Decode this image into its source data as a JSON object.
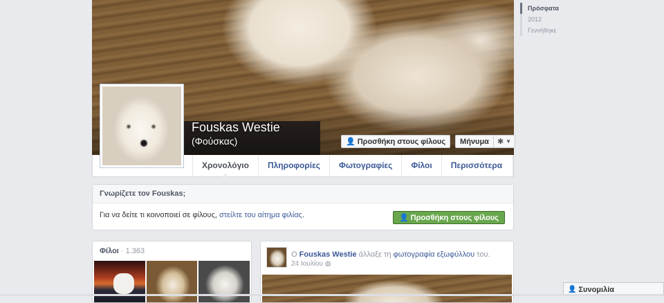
{
  "profile": {
    "name": "Fouskas Westie",
    "alternate_name": "(Φούσκας)"
  },
  "actions": {
    "add_friend": "Προσθήκη στους φίλους",
    "message": "Μήνυμα"
  },
  "tabs": [
    {
      "label": "Χρονολόγιο"
    },
    {
      "label": "Πληροφορίες"
    },
    {
      "label": "Φωτογραφίες"
    },
    {
      "label": "Φίλοι"
    },
    {
      "label": "Περισσότερα"
    }
  ],
  "know_box": {
    "title": "Γνωρίζετε τον Fouskas;",
    "text_prefix": "Για να δείτε τι κοινοποιεί σε φίλους, ",
    "link": "στείλτε του αίτημα φιλίας",
    "text_suffix": ".",
    "button": "Προσθήκη στους φίλους"
  },
  "friends": {
    "title": "Φίλοι",
    "separator": " · ",
    "count": "1.363"
  },
  "story": {
    "prefix": "Ο ",
    "actor": "Fouskas Westie",
    "action": " άλλαξε τη ",
    "object": "φωτογραφία εξωφύλλου",
    "suffix": " του.",
    "date": "24 Ιουλίου"
  },
  "timeline_nav": [
    {
      "label": "Πρόσφατα"
    },
    {
      "label": "2012"
    },
    {
      "label": "Γεννήθηκε"
    }
  ],
  "chat": {
    "label": "Συνομιλία"
  }
}
